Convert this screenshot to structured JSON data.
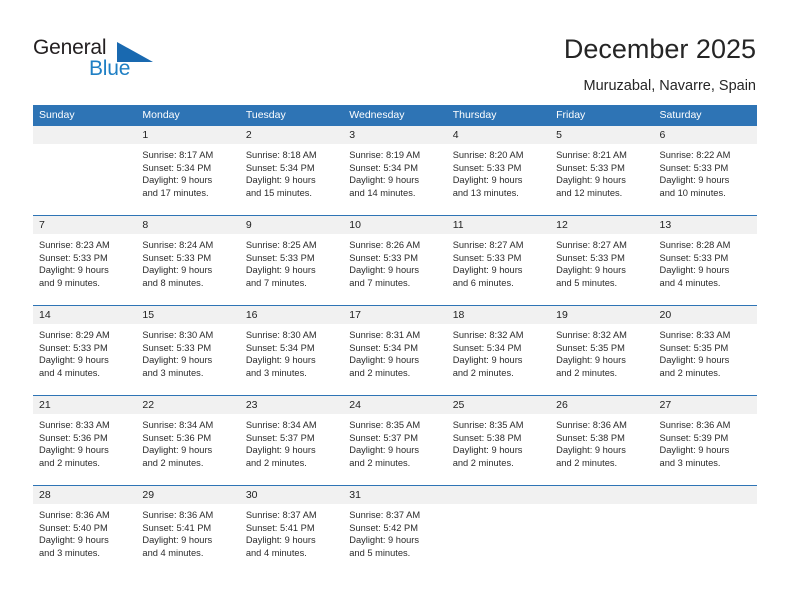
{
  "brand": {
    "name_part1": "General",
    "name_part2": "Blue",
    "logo_icon": "triangle-flag-icon",
    "color_dark": "#231f20",
    "color_blue": "#1f7fc4",
    "color_triangle": "#1969b0"
  },
  "header": {
    "title": "December 2025",
    "subtitle": "Muruzabal, Navarre, Spain"
  },
  "theme": {
    "header_blue": "#2e74b5",
    "day_band_gray": "#f1f1f1",
    "text": "#2b2b2b"
  },
  "calendar": {
    "weekday_headers": [
      "Sunday",
      "Monday",
      "Tuesday",
      "Wednesday",
      "Thursday",
      "Friday",
      "Saturday"
    ],
    "weeks": [
      [
        {
          "day": "",
          "lines": []
        },
        {
          "day": "1",
          "lines": [
            "Sunrise: 8:17 AM",
            "Sunset: 5:34 PM",
            "Daylight: 9 hours",
            "and 17 minutes."
          ]
        },
        {
          "day": "2",
          "lines": [
            "Sunrise: 8:18 AM",
            "Sunset: 5:34 PM",
            "Daylight: 9 hours",
            "and 15 minutes."
          ]
        },
        {
          "day": "3",
          "lines": [
            "Sunrise: 8:19 AM",
            "Sunset: 5:34 PM",
            "Daylight: 9 hours",
            "and 14 minutes."
          ]
        },
        {
          "day": "4",
          "lines": [
            "Sunrise: 8:20 AM",
            "Sunset: 5:33 PM",
            "Daylight: 9 hours",
            "and 13 minutes."
          ]
        },
        {
          "day": "5",
          "lines": [
            "Sunrise: 8:21 AM",
            "Sunset: 5:33 PM",
            "Daylight: 9 hours",
            "and 12 minutes."
          ]
        },
        {
          "day": "6",
          "lines": [
            "Sunrise: 8:22 AM",
            "Sunset: 5:33 PM",
            "Daylight: 9 hours",
            "and 10 minutes."
          ]
        }
      ],
      [
        {
          "day": "7",
          "lines": [
            "Sunrise: 8:23 AM",
            "Sunset: 5:33 PM",
            "Daylight: 9 hours",
            "and 9 minutes."
          ]
        },
        {
          "day": "8",
          "lines": [
            "Sunrise: 8:24 AM",
            "Sunset: 5:33 PM",
            "Daylight: 9 hours",
            "and 8 minutes."
          ]
        },
        {
          "day": "9",
          "lines": [
            "Sunrise: 8:25 AM",
            "Sunset: 5:33 PM",
            "Daylight: 9 hours",
            "and 7 minutes."
          ]
        },
        {
          "day": "10",
          "lines": [
            "Sunrise: 8:26 AM",
            "Sunset: 5:33 PM",
            "Daylight: 9 hours",
            "and 7 minutes."
          ]
        },
        {
          "day": "11",
          "lines": [
            "Sunrise: 8:27 AM",
            "Sunset: 5:33 PM",
            "Daylight: 9 hours",
            "and 6 minutes."
          ]
        },
        {
          "day": "12",
          "lines": [
            "Sunrise: 8:27 AM",
            "Sunset: 5:33 PM",
            "Daylight: 9 hours",
            "and 5 minutes."
          ]
        },
        {
          "day": "13",
          "lines": [
            "Sunrise: 8:28 AM",
            "Sunset: 5:33 PM",
            "Daylight: 9 hours",
            "and 4 minutes."
          ]
        }
      ],
      [
        {
          "day": "14",
          "lines": [
            "Sunrise: 8:29 AM",
            "Sunset: 5:33 PM",
            "Daylight: 9 hours",
            "and 4 minutes."
          ]
        },
        {
          "day": "15",
          "lines": [
            "Sunrise: 8:30 AM",
            "Sunset: 5:33 PM",
            "Daylight: 9 hours",
            "and 3 minutes."
          ]
        },
        {
          "day": "16",
          "lines": [
            "Sunrise: 8:30 AM",
            "Sunset: 5:34 PM",
            "Daylight: 9 hours",
            "and 3 minutes."
          ]
        },
        {
          "day": "17",
          "lines": [
            "Sunrise: 8:31 AM",
            "Sunset: 5:34 PM",
            "Daylight: 9 hours",
            "and 2 minutes."
          ]
        },
        {
          "day": "18",
          "lines": [
            "Sunrise: 8:32 AM",
            "Sunset: 5:34 PM",
            "Daylight: 9 hours",
            "and 2 minutes."
          ]
        },
        {
          "day": "19",
          "lines": [
            "Sunrise: 8:32 AM",
            "Sunset: 5:35 PM",
            "Daylight: 9 hours",
            "and 2 minutes."
          ]
        },
        {
          "day": "20",
          "lines": [
            "Sunrise: 8:33 AM",
            "Sunset: 5:35 PM",
            "Daylight: 9 hours",
            "and 2 minutes."
          ]
        }
      ],
      [
        {
          "day": "21",
          "lines": [
            "Sunrise: 8:33 AM",
            "Sunset: 5:36 PM",
            "Daylight: 9 hours",
            "and 2 minutes."
          ]
        },
        {
          "day": "22",
          "lines": [
            "Sunrise: 8:34 AM",
            "Sunset: 5:36 PM",
            "Daylight: 9 hours",
            "and 2 minutes."
          ]
        },
        {
          "day": "23",
          "lines": [
            "Sunrise: 8:34 AM",
            "Sunset: 5:37 PM",
            "Daylight: 9 hours",
            "and 2 minutes."
          ]
        },
        {
          "day": "24",
          "lines": [
            "Sunrise: 8:35 AM",
            "Sunset: 5:37 PM",
            "Daylight: 9 hours",
            "and 2 minutes."
          ]
        },
        {
          "day": "25",
          "lines": [
            "Sunrise: 8:35 AM",
            "Sunset: 5:38 PM",
            "Daylight: 9 hours",
            "and 2 minutes."
          ]
        },
        {
          "day": "26",
          "lines": [
            "Sunrise: 8:36 AM",
            "Sunset: 5:38 PM",
            "Daylight: 9 hours",
            "and 2 minutes."
          ]
        },
        {
          "day": "27",
          "lines": [
            "Sunrise: 8:36 AM",
            "Sunset: 5:39 PM",
            "Daylight: 9 hours",
            "and 3 minutes."
          ]
        }
      ],
      [
        {
          "day": "28",
          "lines": [
            "Sunrise: 8:36 AM",
            "Sunset: 5:40 PM",
            "Daylight: 9 hours",
            "and 3 minutes."
          ]
        },
        {
          "day": "29",
          "lines": [
            "Sunrise: 8:36 AM",
            "Sunset: 5:41 PM",
            "Daylight: 9 hours",
            "and 4 minutes."
          ]
        },
        {
          "day": "30",
          "lines": [
            "Sunrise: 8:37 AM",
            "Sunset: 5:41 PM",
            "Daylight: 9 hours",
            "and 4 minutes."
          ]
        },
        {
          "day": "31",
          "lines": [
            "Sunrise: 8:37 AM",
            "Sunset: 5:42 PM",
            "Daylight: 9 hours",
            "and 5 minutes."
          ]
        },
        {
          "day": "",
          "lines": []
        },
        {
          "day": "",
          "lines": []
        },
        {
          "day": "",
          "lines": []
        }
      ]
    ]
  }
}
